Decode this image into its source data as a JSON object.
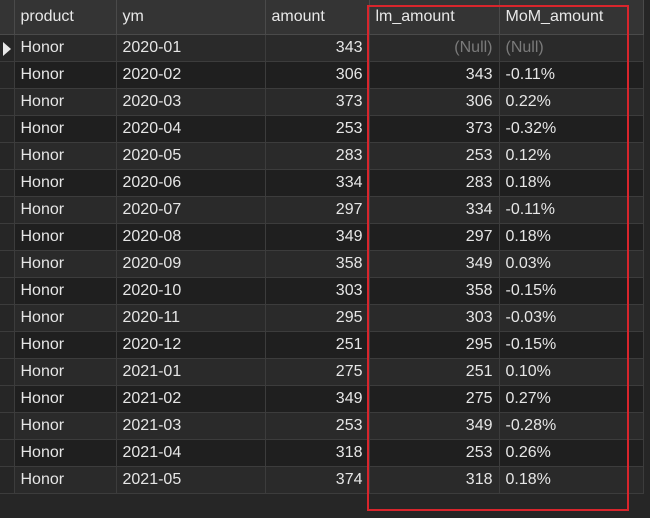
{
  "table": {
    "columns": [
      "product",
      "ym",
      "amount",
      "lm_amount",
      "MoM_amount"
    ],
    "rows": [
      {
        "product": "Honor",
        "ym": "2020-01",
        "amount": "343",
        "lm_amount": "(Null)",
        "mom_amount": "(Null)"
      },
      {
        "product": "Honor",
        "ym": "2020-02",
        "amount": "306",
        "lm_amount": "343",
        "mom_amount": "-0.11%"
      },
      {
        "product": "Honor",
        "ym": "2020-03",
        "amount": "373",
        "lm_amount": "306",
        "mom_amount": "0.22%"
      },
      {
        "product": "Honor",
        "ym": "2020-04",
        "amount": "253",
        "lm_amount": "373",
        "mom_amount": "-0.32%"
      },
      {
        "product": "Honor",
        "ym": "2020-05",
        "amount": "283",
        "lm_amount": "253",
        "mom_amount": "0.12%"
      },
      {
        "product": "Honor",
        "ym": "2020-06",
        "amount": "334",
        "lm_amount": "283",
        "mom_amount": "0.18%"
      },
      {
        "product": "Honor",
        "ym": "2020-07",
        "amount": "297",
        "lm_amount": "334",
        "mom_amount": "-0.11%"
      },
      {
        "product": "Honor",
        "ym": "2020-08",
        "amount": "349",
        "lm_amount": "297",
        "mom_amount": "0.18%"
      },
      {
        "product": "Honor",
        "ym": "2020-09",
        "amount": "358",
        "lm_amount": "349",
        "mom_amount": "0.03%"
      },
      {
        "product": "Honor",
        "ym": "2020-10",
        "amount": "303",
        "lm_amount": "358",
        "mom_amount": "-0.15%"
      },
      {
        "product": "Honor",
        "ym": "2020-11",
        "amount": "295",
        "lm_amount": "303",
        "mom_amount": "-0.03%"
      },
      {
        "product": "Honor",
        "ym": "2020-12",
        "amount": "251",
        "lm_amount": "295",
        "mom_amount": "-0.15%"
      },
      {
        "product": "Honor",
        "ym": "2021-01",
        "amount": "275",
        "lm_amount": "251",
        "mom_amount": "0.10%"
      },
      {
        "product": "Honor",
        "ym": "2021-02",
        "amount": "349",
        "lm_amount": "275",
        "mom_amount": "0.27%"
      },
      {
        "product": "Honor",
        "ym": "2021-03",
        "amount": "253",
        "lm_amount": "349",
        "mom_amount": "-0.28%"
      },
      {
        "product": "Honor",
        "ym": "2021-04",
        "amount": "318",
        "lm_amount": "253",
        "mom_amount": "0.26%"
      },
      {
        "product": "Honor",
        "ym": "2021-05",
        "amount": "374",
        "lm_amount": "318",
        "mom_amount": "0.18%"
      }
    ],
    "current_row_index": 0
  },
  "icons": {
    "current_row": "current-row-arrow-icon"
  },
  "colors": {
    "background": "#262626",
    "row_odd": "#2a2a2a",
    "row_even": "#1f1f1f",
    "header": "#343434",
    "grid_line": "#3c3c3c",
    "text": "#e6e6e6",
    "null_text": "#7a7a7a",
    "highlight": "#d8252c"
  }
}
